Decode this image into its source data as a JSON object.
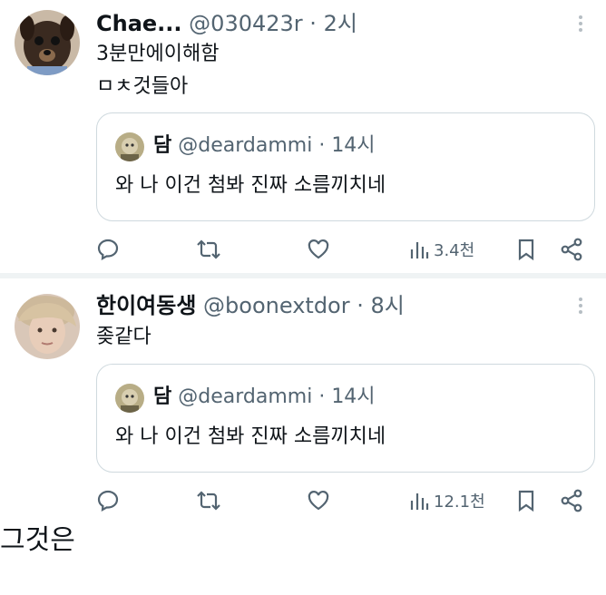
{
  "tweets": [
    {
      "display_name": "Chae...",
      "handle": "@030423r",
      "separator": "·",
      "time": "2시",
      "lines": [
        "3분만에이해함",
        "ㅁㅊ것들아"
      ],
      "quote": {
        "display_name": "담",
        "handle": "@deardammi",
        "separator": "·",
        "time": "14시",
        "text": "와 나 이건 첨봐 진짜 소름끼치네"
      },
      "views": "3.4천"
    },
    {
      "display_name": "한이여동생",
      "handle": "@boonextdor",
      "separator": "·",
      "time": "8시",
      "lines": [
        "좆같다"
      ],
      "quote": {
        "display_name": "담",
        "handle": "@deardammi",
        "separator": "·",
        "time": "14시",
        "text": "와 나 이건 첨봐 진짜 소름끼치네"
      },
      "views": "12.1천"
    }
  ],
  "caption": "그것은",
  "icons": {
    "reply": "reply-icon",
    "retweet": "retweet-icon",
    "like": "heart-icon",
    "views": "views-chart-icon",
    "bookmark": "bookmark-icon",
    "share": "share-icon",
    "more": "more-icon"
  },
  "colors": {
    "text": "#0f1419",
    "secondary": "#536471",
    "border": "#cfd9de"
  }
}
